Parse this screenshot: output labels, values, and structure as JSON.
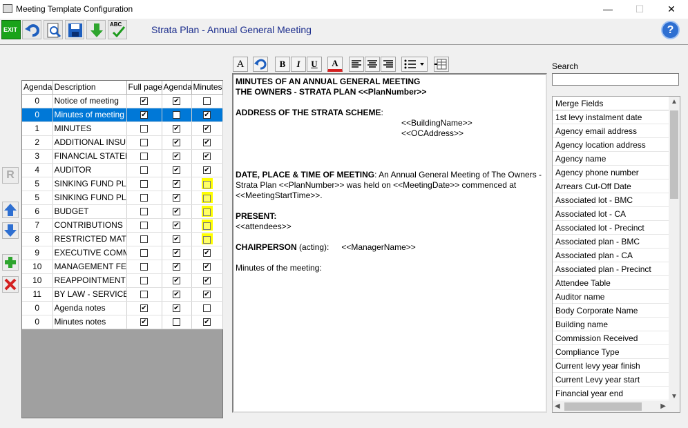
{
  "window": {
    "title": "Meeting Template Configuration",
    "minimize": "—",
    "maximize": "☐",
    "close": "✕"
  },
  "toolbar": {
    "plan_title": "Strata Plan - Annual General Meeting",
    "exit_label": "EXIT",
    "spell_label": "ABC",
    "help_label": "?"
  },
  "side_buttons": {
    "r_label": "R"
  },
  "grid": {
    "headers": [
      "Agenda",
      "Description",
      "Full page",
      "Agenda",
      "Minutes"
    ],
    "rows": [
      {
        "agenda": "0",
        "desc": "Notice of meeting",
        "full": true,
        "ag": true,
        "min": false,
        "hl": false,
        "sel": false
      },
      {
        "agenda": "0",
        "desc": "Minutes of meeting",
        "full": true,
        "ag": false,
        "min": true,
        "hl": false,
        "sel": true
      },
      {
        "agenda": "1",
        "desc": "MINUTES",
        "full": false,
        "ag": true,
        "min": true,
        "hl": false,
        "sel": false
      },
      {
        "agenda": "2",
        "desc": "ADDITIONAL INSUR",
        "full": false,
        "ag": true,
        "min": true,
        "hl": false,
        "sel": false
      },
      {
        "agenda": "3",
        "desc": "FINANCIAL STATEM",
        "full": false,
        "ag": true,
        "min": true,
        "hl": false,
        "sel": false
      },
      {
        "agenda": "4",
        "desc": "AUDITOR",
        "full": false,
        "ag": true,
        "min": true,
        "hl": false,
        "sel": false
      },
      {
        "agenda": "5",
        "desc": "SINKING FUND PLA",
        "full": false,
        "ag": true,
        "min": false,
        "hl": true,
        "sel": false
      },
      {
        "agenda": "5",
        "desc": "SINKING FUND PLA",
        "full": false,
        "ag": true,
        "min": false,
        "hl": true,
        "sel": false
      },
      {
        "agenda": "6",
        "desc": "BUDGET",
        "full": false,
        "ag": true,
        "min": false,
        "hl": true,
        "sel": false
      },
      {
        "agenda": "7",
        "desc": "CONTRIBUTIONS",
        "full": false,
        "ag": true,
        "min": false,
        "hl": true,
        "sel": false
      },
      {
        "agenda": "8",
        "desc": "RESTRICTED MATT",
        "full": false,
        "ag": true,
        "min": false,
        "hl": true,
        "sel": false
      },
      {
        "agenda": "9",
        "desc": "EXECUTIVE COMMI",
        "full": false,
        "ag": true,
        "min": true,
        "hl": false,
        "sel": false
      },
      {
        "agenda": "10",
        "desc": "MANAGEMENT FEE",
        "full": false,
        "ag": true,
        "min": true,
        "hl": false,
        "sel": false
      },
      {
        "agenda": "10",
        "desc": "REAPPOINTMENT C",
        "full": false,
        "ag": true,
        "min": true,
        "hl": false,
        "sel": false
      },
      {
        "agenda": "11",
        "desc": "BY LAW - SERVICE (",
        "full": false,
        "ag": true,
        "min": true,
        "hl": false,
        "sel": false
      },
      {
        "agenda": "0",
        "desc": "Agenda notes",
        "full": true,
        "ag": true,
        "min": false,
        "hl": false,
        "sel": false
      },
      {
        "agenda": "0",
        "desc": "Minutes notes",
        "full": true,
        "ag": false,
        "min": true,
        "hl": false,
        "sel": false
      }
    ]
  },
  "editor_toolbar": {
    "font_label": "A",
    "bold_label": "B",
    "italic_label": "I",
    "underline_label": "U",
    "color_label": "A"
  },
  "editor": {
    "heading1": "MINUTES OF AN ANNUAL GENERAL MEETING",
    "heading2": "THE OWNERS - STRATA PLAN <<PlanNumber>>",
    "address_label": "ADDRESS OF THE STRATA SCHEME",
    "address_colon": ":",
    "building_name": "<<BuildingName>>",
    "oc_address": "<<OCAddress>>",
    "date_label": "DATE, PLACE & TIME OF MEETING",
    "date_text_1": ": An Annual General Meeting of The Owners -",
    "date_text_2": "Strata Plan <<PlanNumber>> was held on <<MeetingDate>> commenced at",
    "date_text_3": "<<MeetingStartTime>>.",
    "present_label": "PRESENT:",
    "attendees": "<<attendees>>",
    "chair_label": "CHAIRPERSON",
    "chair_acting": " (acting):",
    "manager_name": "<<ManagerName>>",
    "minutes_line": "Minutes of the meeting:"
  },
  "search": {
    "label": "Search",
    "value": ""
  },
  "merge_fields": {
    "header": "Merge Fields",
    "items": [
      "1st levy instalment date",
      "Agency email address",
      "Agency location address",
      "Agency name",
      "Agency phone number",
      "Arrears Cut-Off Date",
      "Associated lot - BMC",
      "Associated lot - CA",
      "Associated lot - Precinct",
      "Associated plan - BMC",
      "Associated plan - CA",
      "Associated plan - Precinct",
      "Attendee Table",
      "Auditor name",
      "Body Corporate Name",
      "Building name",
      "Commission Received",
      "Compliance Type",
      "Current levy year finish",
      "Current Levy year start",
      "Financial year end"
    ]
  }
}
